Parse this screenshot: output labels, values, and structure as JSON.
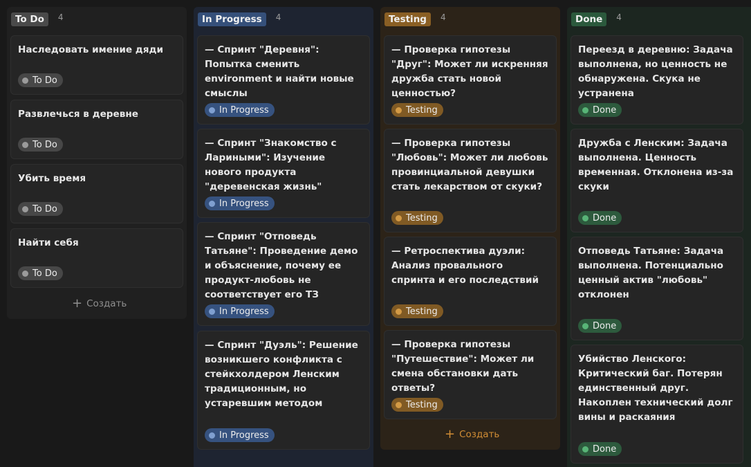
{
  "columns": [
    {
      "title": "To Do",
      "count": "4",
      "create_label": "Создать",
      "cards": [
        {
          "title": "Наследовать имение дяди",
          "status": "To Do"
        },
        {
          "title": "Развлечься в деревне",
          "status": "To Do"
        },
        {
          "title": "Убить время",
          "status": "To Do"
        },
        {
          "title": "Найти себя",
          "status": "To Do"
        }
      ]
    },
    {
      "title": "In Progress",
      "count": "4",
      "cards": [
        {
          "title": "— Спринт \"Деревня\": Попытка сменить environment и найти новые смыслы",
          "status": "In Progress"
        },
        {
          "title": "— Спринт \"Знакомство с Лариными\": Изучение нового продукта \"деревенская жизнь\"",
          "status": "In Progress"
        },
        {
          "title": "— Спринт \"Отповедь Татьяне\": Проведение демо и объяснение, почему ее продукт-любовь не соответствует его ТЗ",
          "status": "In Progress"
        },
        {
          "title": "— Спринт \"Дуэль\": Решение возникшего конфликта с стейкхолдером Ленским традиционным, но устаревшим методом",
          "status": "In Progress"
        }
      ]
    },
    {
      "title": "Testing",
      "count": "4",
      "create_label": "Создать",
      "cards": [
        {
          "title": "— Проверка гипотезы \"Друг\": Может ли искренняя дружба стать новой ценностью?",
          "status": "Testing"
        },
        {
          "title": "— Проверка гипотезы \"Любовь\": Может ли любовь провинциальной девушки стать лекарством от скуки?",
          "status": "Testing"
        },
        {
          "title": "— Ретроспектива дуэли: Анализ провального спринта и его последствий",
          "status": "Testing"
        },
        {
          "title": "— Проверка гипотезы \"Путешествие\": Может ли смена обстановки дать ответы?",
          "status": "Testing"
        }
      ]
    },
    {
      "title": "Done",
      "count": "4",
      "cards": [
        {
          "title": "Переезд в деревню: Задача выполнена, но ценность не обнаружена. Скука не устранена",
          "status": "Done"
        },
        {
          "title": "Дружба с Ленским: Задача выполнена. Ценность временная. Отклонена из-за скуки",
          "status": "Done"
        },
        {
          "title": "Отповедь Татьяне: Задача выполнена. Потенциально ценный актив \"любовь\" отклонен",
          "status": "Done"
        },
        {
          "title": "Убийство Ленского: Критический баг. Потерян единственный друг. Накоплен технический долг вины и раскаяния",
          "status": "Done"
        }
      ]
    }
  ],
  "colors": {
    "todo_bg": "#202020",
    "todo_tag": "#4a4a4a",
    "todo_pill": "#474747",
    "todo_dot": "#9b9b9b",
    "progress_bg": "#1e2431",
    "progress_tag": "#35507a",
    "progress_pill": "#36527f",
    "progress_dot": "#7f9fd0",
    "testing_bg": "#2c2318",
    "testing_tag": "#8a5f24",
    "testing_pill": "#805a24",
    "testing_dot": "#d39a45",
    "testing_create": "#d08c34",
    "done_bg": "#1c2620",
    "done_tag": "#2b593c",
    "done_pill": "#2d5a3d",
    "done_dot": "#58b477",
    "create_text": "#8f8f8f"
  },
  "icons": {
    "create": "plus-icon",
    "status": "status-dot"
  }
}
